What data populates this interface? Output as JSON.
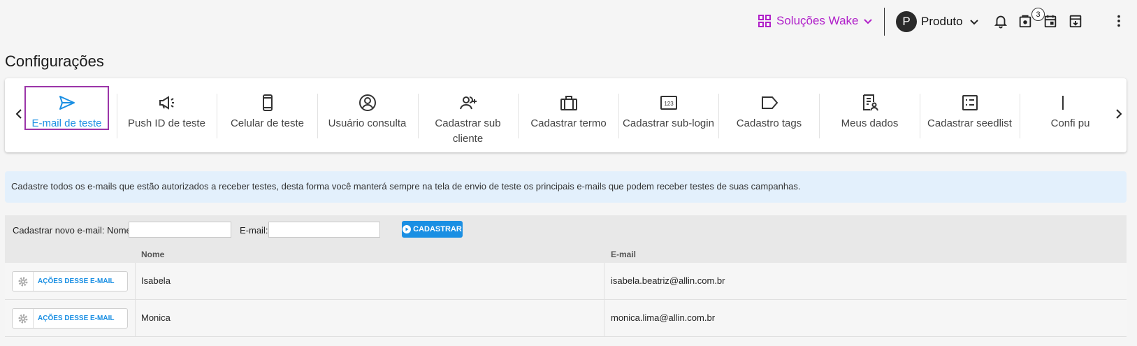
{
  "header": {
    "solutions_label": "Soluções Wake",
    "product_avatar": "P",
    "product_label": "Produto",
    "cart_badge": "3",
    "icons": [
      "grid-icon",
      "chevron-down-icon",
      "bell-icon",
      "cart-icon",
      "calendar-icon",
      "download-box-icon",
      "more-vert-icon"
    ]
  },
  "page": {
    "title": "Configurações"
  },
  "settings_tabs": [
    {
      "label": "E-mail de teste",
      "icon": "send-icon",
      "active": true
    },
    {
      "label": "Push ID de teste",
      "icon": "megaphone-icon"
    },
    {
      "label": "Celular de teste",
      "icon": "smartphone-icon"
    },
    {
      "label": "Usuário consulta",
      "icon": "user-circle-icon"
    },
    {
      "label": "Cadastrar sub cliente",
      "icon": "group-add-icon"
    },
    {
      "label": "Cadastrar termo",
      "icon": "briefcase-icon"
    },
    {
      "label": "Cadastrar sub-login",
      "icon": "numeric-box-icon"
    },
    {
      "label": "Cadastro tags",
      "icon": "tag-icon"
    },
    {
      "label": "Meus dados",
      "icon": "user-document-icon"
    },
    {
      "label": "Cadastrar seedlist",
      "icon": "checklist-icon"
    },
    {
      "label": "Confi pu",
      "icon": "partial-icon"
    }
  ],
  "info": {
    "text": "Cadastre todos os e-mails que estão autorizados a receber testes, desta forma você manterá sempre na tela de envio de teste os principais e-mails que podem receber testes de suas campanhas."
  },
  "form": {
    "name_label": "Cadastrar novo e-mail: Nome:",
    "name_value": "",
    "email_label": "E-mail:",
    "email_value": "",
    "submit_label": "CADASTRAR"
  },
  "table": {
    "columns": [
      "",
      "Nome",
      "E-mail"
    ],
    "action_label": "AÇÕES DESSE E-MAIL",
    "rows": [
      {
        "name": "Isabela",
        "email": "isabela.beatriz@allin.com.br"
      },
      {
        "name": "Monica",
        "email": "monica.lima@allin.com.br"
      }
    ]
  },
  "colors": {
    "accent": "#1a8fe3",
    "brand": "#b01fc9",
    "active_outline": "#9b35a8",
    "info_bg": "#e3f0fc"
  }
}
